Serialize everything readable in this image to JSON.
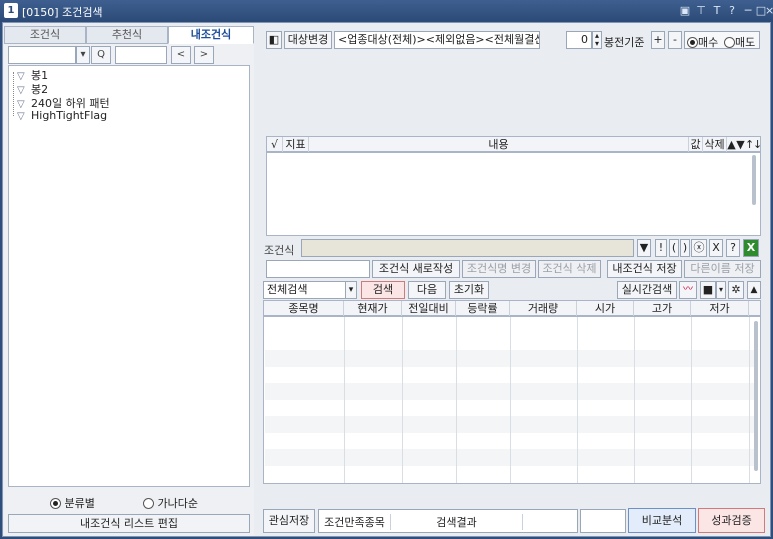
{
  "window": {
    "number": "1",
    "title": "[0150] 조건검색",
    "controls": [
      "▣",
      "⊤",
      "T",
      "?",
      "─",
      "□",
      "×"
    ]
  },
  "left": {
    "tabs": [
      {
        "label": "조건식",
        "active": false
      },
      {
        "label": "추천식",
        "active": false
      },
      {
        "label": "내조건식",
        "active": true
      }
    ],
    "search": {
      "value": "",
      "dropdown": "▾",
      "search_icon": "Q",
      "text": "",
      "prev": "<",
      "next": ">"
    },
    "tree": [
      "봉1",
      "봉2",
      "240일 하위 패턴",
      "HighTightFlag"
    ],
    "sort": {
      "option1": "분류별",
      "option2": "가나다순",
      "selected": "분류별"
    },
    "edit_button": "내조건식 리스트 편집"
  },
  "right": {
    "toolbar": {
      "target_change": "대상변경",
      "target_value": "<업종대상(전체)><제외없음><전체월결산>",
      "bong_value": "0",
      "bong_label": "봉전기준",
      "plus": "+",
      "minus": "-",
      "buy_label": "매수",
      "sell_label": "매도",
      "buy_selected": true
    },
    "condition_table": {
      "headers": [
        "√",
        "지표",
        "내용",
        "값",
        "삭제",
        "▲",
        "▼",
        "↑",
        "↓"
      ]
    },
    "condition": {
      "label": "조건식",
      "value": "",
      "ops": [
        "▼",
        "!",
        "(",
        ")",
        "ⓧ",
        "X",
        "?"
      ]
    },
    "actions": {
      "name_value": "",
      "new": "조건식 새로작성",
      "rename": "조건식명 변경",
      "delete": "조건식 삭제",
      "save": "내조건식 저장",
      "save_as": "다른이름 저장"
    },
    "search_bar": {
      "scope": "전체검색",
      "search": "검색",
      "next": "다음",
      "reset": "초기화",
      "realtime": "실시간검색"
    },
    "result_table": {
      "headers": [
        "종목명",
        "현재가",
        "전일대비",
        "등락률",
        "거래량",
        "시가",
        "고가",
        "저가"
      ]
    },
    "footer": {
      "watch_save": "관심저장",
      "condition_met": "조건만족종목",
      "search_result": "검색결과",
      "compare": "비교분석",
      "performance": "성과검증"
    }
  }
}
